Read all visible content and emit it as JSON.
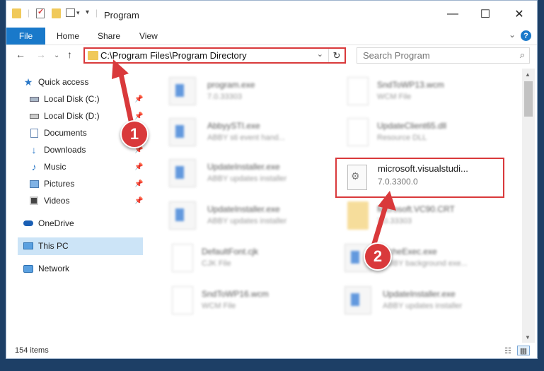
{
  "window": {
    "title": "Program",
    "controls": {
      "minimize": "—",
      "maximize": "☐",
      "close": "✕"
    }
  },
  "ribbon": {
    "file": "File",
    "tabs": [
      "Home",
      "Share",
      "View"
    ],
    "help": "?"
  },
  "address": {
    "path": "C:\\Program Files\\Program Directory",
    "refresh": "↻",
    "dropdown": "⌄"
  },
  "search": {
    "placeholder": "Search Program"
  },
  "sidebar": {
    "quick_access": "Quick access",
    "items": [
      {
        "label": "Local Disk (C:)",
        "icon": "drive-icon",
        "pinned": true
      },
      {
        "label": "Local Disk (D:)",
        "icon": "drive-icon",
        "pinned": true
      },
      {
        "label": "Documents",
        "icon": "documents-icon",
        "pinned": true
      },
      {
        "label": "Downloads",
        "icon": "downloads-icon",
        "pinned": true
      },
      {
        "label": "Music",
        "icon": "music-icon",
        "pinned": true
      },
      {
        "label": "Pictures",
        "icon": "pictures-icon",
        "pinned": true
      },
      {
        "label": "Videos",
        "icon": "videos-icon",
        "pinned": true
      }
    ],
    "onedrive": "OneDrive",
    "this_pc": "This PC",
    "network": "Network"
  },
  "files": {
    "left": [
      {
        "name": "program.exe",
        "sub": "7.0.33303"
      },
      {
        "name": "AbbyySTI.exe",
        "sub": "ABBY sti event hand..."
      },
      {
        "name": "UpdateInstaller.exe",
        "sub": "ABBY updates installer"
      },
      {
        "name": "UpdateInstaller.exe",
        "sub": "ABBY updates installer"
      },
      {
        "name": "DefaultFont.cjk",
        "sub": "CJK File"
      },
      {
        "name": "SndToWP16.wcm",
        "sub": "WCM File"
      }
    ],
    "right": [
      {
        "name": "SndToWP13.wcm",
        "sub": "WCM File"
      },
      {
        "name": "UpdateClient65.dll",
        "sub": "Resource DLL"
      },
      {
        "name": "microsoft.visualstudi...",
        "sub": "7.0.3300.0"
      },
      {
        "name": "Microsoft.VC90.CRT",
        "sub": "7.0.33303"
      },
      {
        "name": "ScheExec.exe",
        "sub": "ABBY background exe..."
      },
      {
        "name": "UpdateInstaller.exe",
        "sub": "ABBY updates installer"
      }
    ]
  },
  "status": {
    "items": "154 items"
  },
  "annotations": {
    "step1": "1",
    "step2": "2"
  },
  "colors": {
    "accent": "#1979ca",
    "annotation": "#d9393b",
    "selected": "#cce4f7"
  }
}
